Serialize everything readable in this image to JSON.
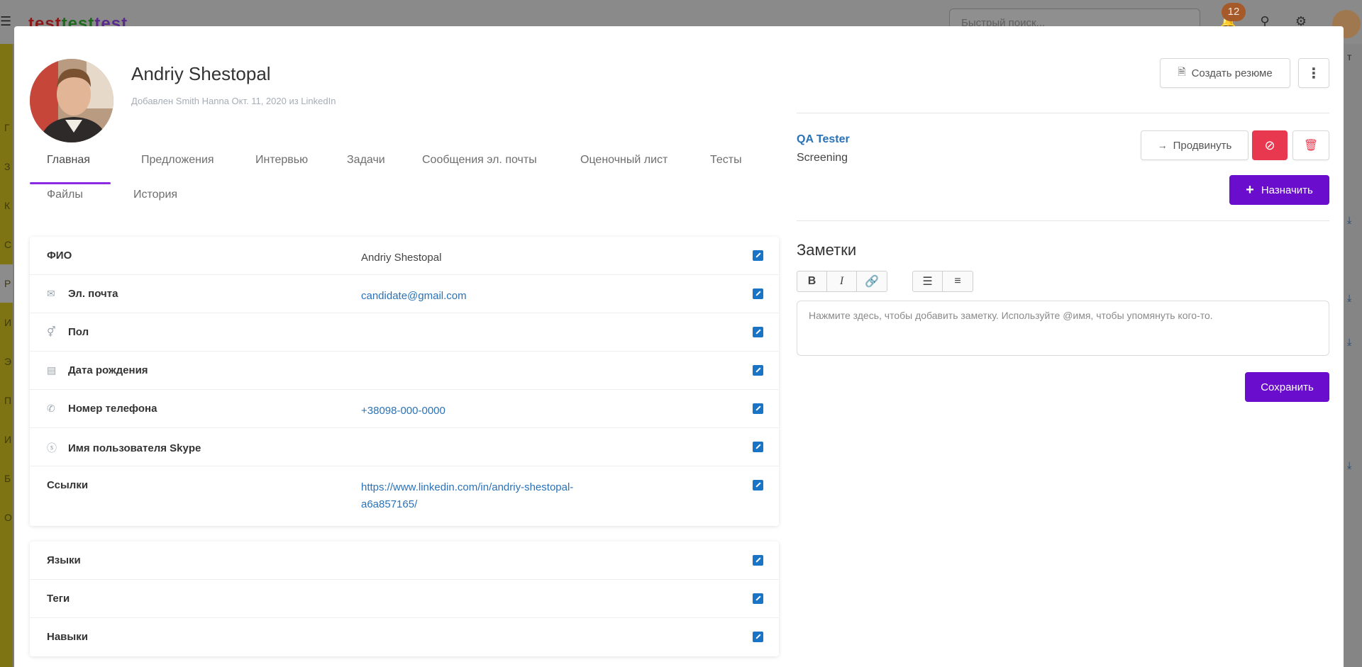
{
  "background": {
    "logo": [
      "test",
      "test",
      "test"
    ],
    "search_placeholder": "Быстрый поиск...",
    "notifications_count": "12",
    "sidebar_letters": [
      "Г",
      "З",
      "К",
      "С",
      "Р",
      "И",
      "Э",
      "П",
      "И",
      "Б",
      "О"
    ],
    "right_column_letter": "т"
  },
  "candidate": {
    "name": "Andriy Shestopal",
    "added_info": "Добавлен Smith Hanna Окт. 11, 2020 из LinkedIn"
  },
  "tabs": [
    {
      "label": "Главная",
      "active": true
    },
    {
      "label": "Предложения"
    },
    {
      "label": "Интервью"
    },
    {
      "label": "Задачи"
    },
    {
      "label": "Сообщения эл. почты"
    },
    {
      "label": "Оценочный лист"
    },
    {
      "label": "Тесты"
    },
    {
      "label": "Файлы"
    },
    {
      "label": "История"
    }
  ],
  "info_fields": [
    {
      "label": "ФИО",
      "icon": "",
      "value": "Andriy Shestopal"
    },
    {
      "label": "Эл. почта",
      "icon": "envelope-icon",
      "value": "candidate@gmail.com"
    },
    {
      "label": "Пол",
      "icon": "gender-icon",
      "value": ""
    },
    {
      "label": "Дата рождения",
      "icon": "birthday-cake-icon",
      "value": ""
    },
    {
      "label": "Номер телефона",
      "icon": "phone-icon",
      "value": "+38098-000-0000"
    },
    {
      "label": "Имя пользователя Skype",
      "icon": "skype-icon",
      "value": ""
    },
    {
      "label": "Ссылки",
      "icon": "",
      "value_line1": "https://www.linkedin.com/in/andriy-shestopal-",
      "value_line2": "a6a857165/"
    }
  ],
  "extra_fields": [
    {
      "label": "Языки"
    },
    {
      "label": "Теги"
    },
    {
      "label": "Навыки"
    }
  ],
  "actions": {
    "create_resume": "Создать резюме",
    "more": "⋮",
    "promote": "Продвинуть",
    "assign": "Назначить"
  },
  "job": {
    "title": "QA Tester",
    "stage": "Screening"
  },
  "notes": {
    "title": "Заметки",
    "toolbar": [
      "B",
      "I",
      "🔗",
      "☰",
      "≡"
    ],
    "placeholder": "Нажмите здесь, чтобы добавить заметку. Используйте @имя, чтобы упомянуть кого-то.",
    "save": "Сохранить"
  },
  "colors": {
    "accent_purple": "#6a0dcc",
    "tab_underline": "#8a2be2",
    "link_blue": "#2a72b8",
    "edit_icon_blue": "#1a74c6",
    "danger_red": "#e8384f"
  }
}
